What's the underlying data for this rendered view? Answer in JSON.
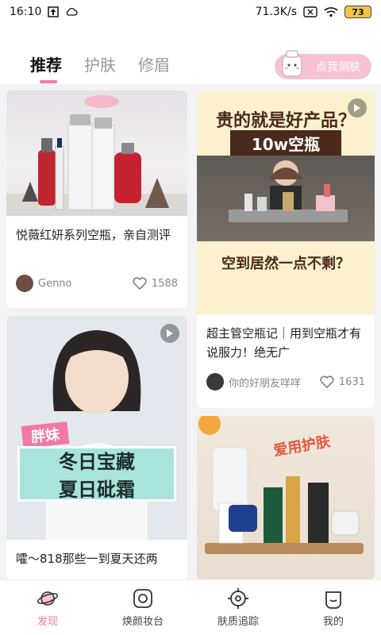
{
  "status_bar": {
    "time": "16:10",
    "net_speed": "71.3K/s",
    "battery": "73"
  },
  "tabs": [
    {
      "label": "推荐"
    },
    {
      "label": "护肤"
    },
    {
      "label": "修眉"
    }
  ],
  "test_button": {
    "label": "点我测肤"
  },
  "cards": [
    {
      "title": "悦薇红妍系列空瓶，亲自测评",
      "author": "Genno",
      "likes": "1588"
    },
    {
      "title": "超主管空瓶记｜用到空瓶才有说服力！绝无广",
      "author": "你的好朋友咩咩",
      "likes": "1631",
      "overlay_top": "贵的就是好产品？",
      "overlay_sub": "10w空瓶",
      "overlay_bottom": "空到居然一点不剩？"
    },
    {
      "title": "嚯～818那些一到夏天还两",
      "overlay_tag": "胖妹",
      "overlay_line1": "冬日宝藏",
      "overlay_line2": "夏日砒霜"
    },
    {
      "overlay_sticker": "爱用护肤"
    }
  ],
  "bottom_nav": [
    {
      "label": "发现"
    },
    {
      "label": "焕颜妆台"
    },
    {
      "label": "肤质追踪"
    },
    {
      "label": "我的"
    }
  ],
  "colors": {
    "accent": "#f47aa0",
    "card_bg": "#ffffff",
    "page_bg": "#f3f3f5"
  }
}
